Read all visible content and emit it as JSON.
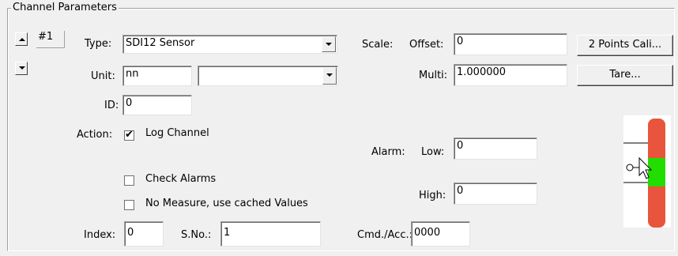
{
  "group_title": "Channel Parameters",
  "channel": {
    "number": "#1",
    "up_icon": "arrow-up-icon",
    "down_icon": "arrow-down-icon"
  },
  "type": {
    "label": "Type:",
    "value": "SDI12 Sensor"
  },
  "unit": {
    "label": "Unit:",
    "value": "nn",
    "select_value": ""
  },
  "id": {
    "label": "ID:",
    "value": "0"
  },
  "action": {
    "label": "Action:"
  },
  "checkboxes": {
    "log_channel": {
      "label": "Log Channel",
      "checked": true
    },
    "check_alarms": {
      "label": "Check Alarms",
      "checked": false
    },
    "no_measure": {
      "label": "No Measure, use cached Values",
      "checked": false
    }
  },
  "scale": {
    "label": "Scale:",
    "offset_label": "Offset:",
    "offset_value": "0",
    "multi_label": "Multi:",
    "multi_value": "1.000000"
  },
  "buttons": {
    "two_points": "2 Points Cali...",
    "tare": "Tare..."
  },
  "alarm": {
    "label": "Alarm:",
    "low_label": "Low:",
    "low_value": "0",
    "high_label": "High:",
    "high_value": "0"
  },
  "index": {
    "label": "Index:",
    "value": "0"
  },
  "sno": {
    "label": "S.No.:",
    "value": "1"
  },
  "cmd": {
    "label": "Cmd./Acc.:",
    "value": "0000"
  },
  "gauge": {
    "colors": {
      "alarm": "#e8553c",
      "ok": "#22dd00"
    },
    "icon": "alarm-level-gauge-icon"
  }
}
